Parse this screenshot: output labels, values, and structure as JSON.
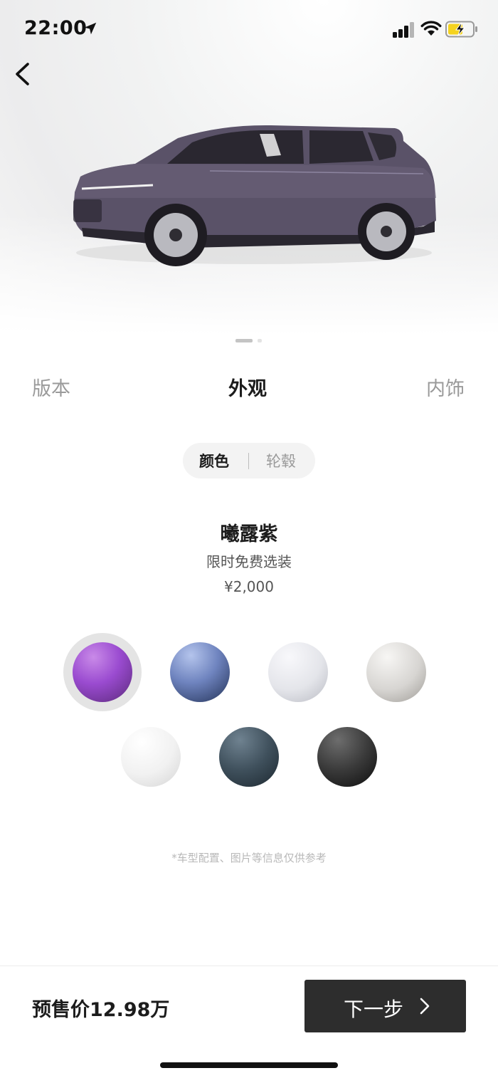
{
  "status_bar": {
    "time": "22:00"
  },
  "tabs": [
    {
      "label": "版本",
      "active": false
    },
    {
      "label": "外观",
      "active": true
    },
    {
      "label": "内饰",
      "active": false
    }
  ],
  "segment": {
    "color_label": "颜色",
    "wheel_label": "轮毂",
    "selected": "颜色"
  },
  "selected_color": {
    "name": "曦露紫",
    "note": "限时免费选装",
    "price": "¥2,000"
  },
  "swatches": [
    {
      "color": "#9a4bd0",
      "selected": true
    },
    {
      "color": "#6f84bf",
      "selected": false
    },
    {
      "color": "#e4e5ea",
      "selected": false
    },
    {
      "color": "#d7d5d2",
      "selected": false
    },
    {
      "color": "#f1f1f1",
      "selected": false
    },
    {
      "color": "#3f505c",
      "selected": false
    },
    {
      "color": "#1a1a1a",
      "selected": false
    }
  ],
  "disclaimer": "*车型配置、图片等信息仅供参考",
  "footer": {
    "presale_price": "预售价12.98万",
    "next_button": "下一步"
  },
  "car": {
    "body_color": "#5a5268"
  },
  "icons": [
    "location-arrow-icon",
    "cellular-signal-icon",
    "wifi-icon",
    "battery-charging-icon",
    "back-chevron-icon",
    "chevron-right-icon"
  ]
}
